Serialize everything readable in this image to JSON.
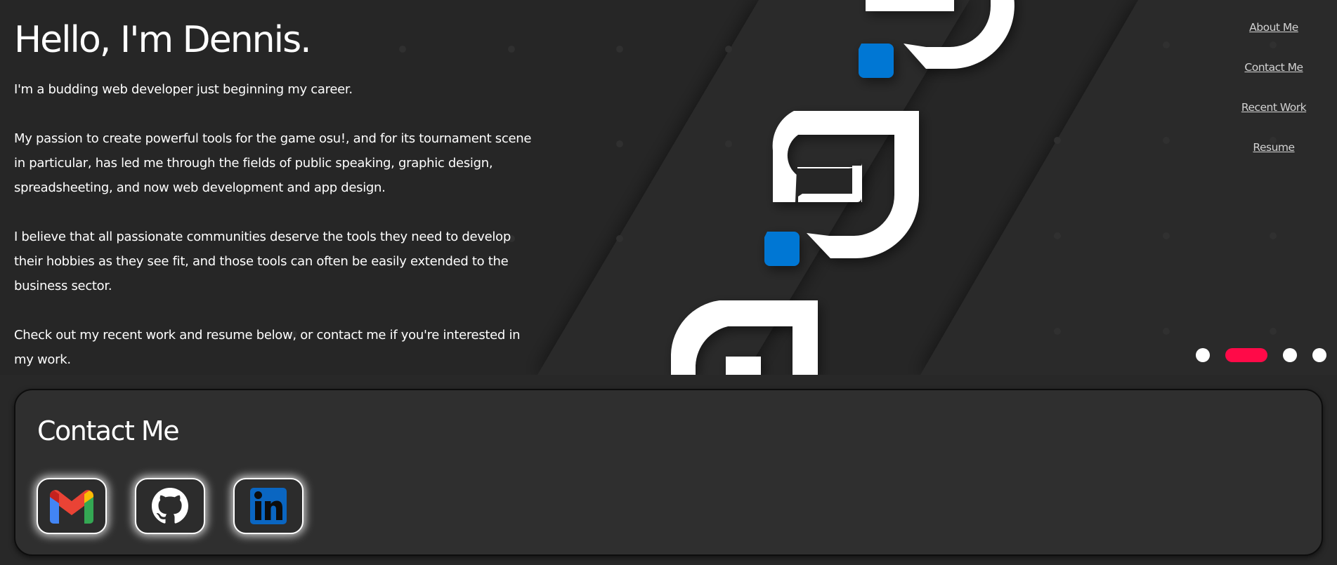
{
  "page": {
    "background": "#282828",
    "accent": "#ff0a48",
    "brand_blue": "#0077d4"
  },
  "intro": {
    "heading": "Hello, I'm Dennis.",
    "paragraphs": [
      "I'm a budding web developer just beginning my career.",
      "My passion to create powerful tools for the game osu!, and for its tournament scene in particular, has led me through the fields of public speaking, graphic design, spreadsheeting, and now web development and app design.",
      "I believe that all passionate communities deserve the tools they need to develop their hobbies as they see fit, and those tools can often be easily extended to the business sector.",
      "Check out my recent work and resume below, or contact me if you're interested in my work."
    ]
  },
  "nav": {
    "items": [
      "About Me",
      "Contact Me",
      "Recent Work",
      "Resume"
    ]
  },
  "carousel": {
    "slide_count": 4,
    "active_index": 1
  },
  "contact": {
    "heading": "Contact Me",
    "links": [
      {
        "label": "Gmail",
        "icon": "gmail-icon"
      },
      {
        "label": "GitHub",
        "icon": "github-icon"
      },
      {
        "label": "LinkedIn",
        "icon": "linkedin-icon"
      }
    ]
  }
}
